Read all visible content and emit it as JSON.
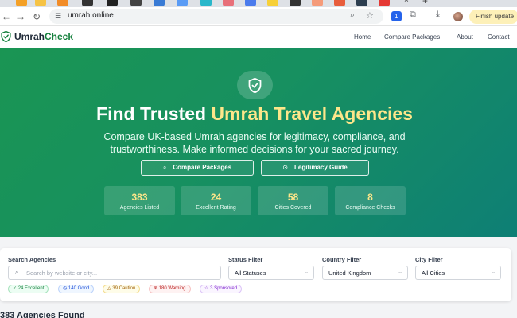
{
  "browser": {
    "url": "umrah.online",
    "finish_update_label": "Finish update",
    "tab_close_glyph": "×",
    "new_tab_glyph": "+",
    "icons": [
      "site-info-icon",
      "zoom-icon",
      "star-icon",
      "extensions-icon",
      "download-icon"
    ]
  },
  "site": {
    "logo_part1": "Umrah",
    "logo_part2": "Check",
    "nav": {
      "home": "Home",
      "compare": "Compare Packages",
      "about": "About",
      "contact": "Contact"
    }
  },
  "hero": {
    "title_part1": "Find Trusted",
    "title_part2": "Umrah Travel Agencies",
    "subtitle": "Compare UK-based Umrah agencies for legitimacy, compliance, and trustworthiness. Make informed decisions for your sacred journey.",
    "btn_compare": "Compare Packages",
    "btn_guide": "Legitimacy Guide",
    "stats": [
      {
        "value": "383",
        "label": "Agencies Listed"
      },
      {
        "value": "24",
        "label": "Excellent Rating"
      },
      {
        "value": "58",
        "label": "Cities Covered"
      },
      {
        "value": "8",
        "label": "Compliance Checks"
      }
    ]
  },
  "filters": {
    "search_label": "Search Agencies",
    "search_placeholder": "Search by website or city...",
    "status_label": "Status Filter",
    "status_value": "All Statuses",
    "country_label": "Country Filter",
    "country_value": "United Kingdom",
    "city_label": "City Filter",
    "city_value": "All Cities",
    "badges": [
      {
        "icon": "✓",
        "text": "24 Excellent"
      },
      {
        "icon": "◷",
        "text": "140 Good"
      },
      {
        "icon": "△",
        "text": "39 Caution"
      },
      {
        "icon": "⊗",
        "text": "180 Warning"
      },
      {
        "icon": "☆",
        "text": "3 Sponsored"
      }
    ]
  },
  "results": {
    "title": "383 Agencies Found"
  },
  "colors": {
    "brand_green": "#15803d",
    "hero_start": "#1a9553",
    "hero_end": "#0e7f75",
    "highlight": "#fde68a"
  }
}
